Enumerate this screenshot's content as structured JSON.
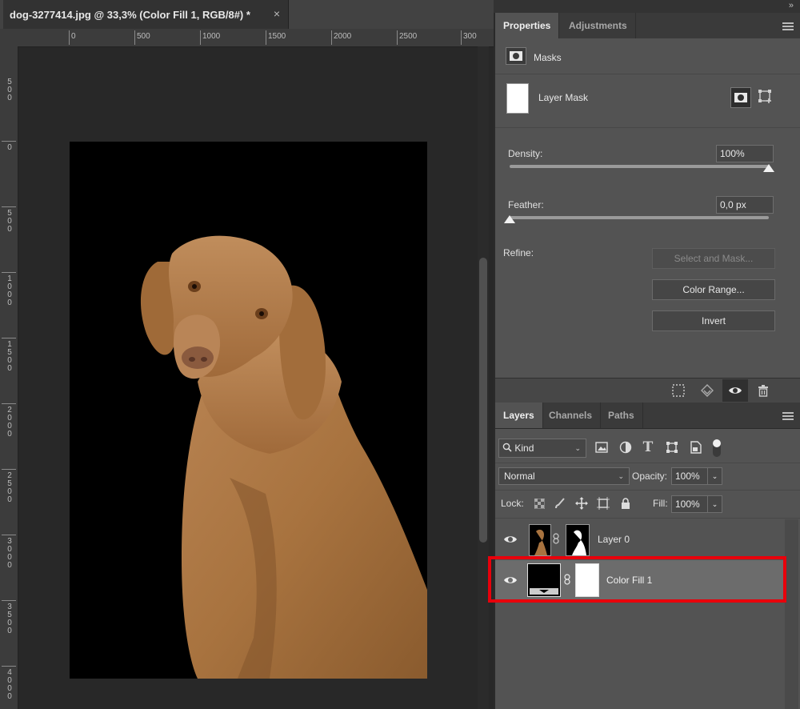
{
  "document": {
    "tab_title": "dog-3277414.jpg @ 33,3% (Color Fill 1, RGB/8#) *",
    "close_glyph": "×",
    "ruler_top": [
      "0",
      "500",
      "1000",
      "1500",
      "2000",
      "2500",
      "300"
    ],
    "ruler_left": [
      "5\n0\n0",
      "0",
      "5\n0\n0",
      "1\n0\n0\n0",
      "1\n5\n0\n0",
      "2\n0\n0\n0",
      "2\n5\n0\n0",
      "3\n0\n0\n0",
      "3\n5\n0\n0",
      "4\n0\n0\n0"
    ]
  },
  "properties_panel": {
    "tabs": [
      "Properties",
      "Adjustments"
    ],
    "active_tab": "Properties",
    "masks_label": "Masks",
    "layer_mask_label": "Layer Mask",
    "density_label": "Density:",
    "density_value": "100%",
    "density_level": 1.0,
    "feather_label": "Feather:",
    "feather_value": "0,0 px",
    "feather_level": 0.0,
    "refine_label": "Refine:",
    "select_and_mask_label": "Select and Mask...",
    "color_range_label": "Color Range...",
    "invert_label": "Invert",
    "bottom_icons": [
      "selection-icon",
      "apply-mask-icon",
      "visibility-icon",
      "trash-icon"
    ]
  },
  "layers_panel": {
    "tabs": [
      "Layers",
      "Channels",
      "Paths"
    ],
    "active_tab": "Layers",
    "filter_kind_label": "Kind",
    "filter_icons": [
      "image-filter-icon",
      "adjustment-filter-icon",
      "type-filter-icon",
      "shape-filter-icon",
      "smart-object-filter-icon"
    ],
    "blend_mode": "Normal",
    "opacity_label": "Opacity:",
    "opacity_value": "100%",
    "lock_label": "Lock:",
    "fill_label": "Fill:",
    "fill_value": "100%",
    "layers": [
      {
        "name": "Layer 0",
        "selected": false
      },
      {
        "name": "Color Fill 1",
        "selected": true
      }
    ],
    "highlight_color": "#e8000b"
  }
}
